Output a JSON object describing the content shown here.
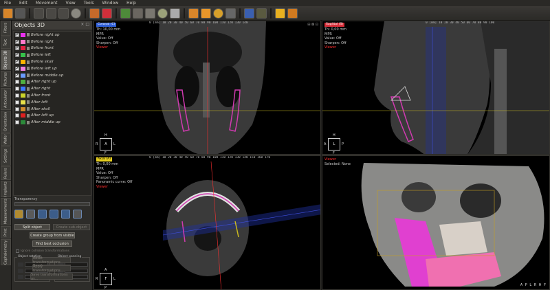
{
  "menu": [
    "File",
    "Edit",
    "Movement",
    "View",
    "Tools",
    "Window",
    "Help"
  ],
  "sidetabs": [
    "Filters",
    "Text",
    "Objects 3D",
    "Pictures",
    "Articulator",
    "Orientation",
    "Wafer",
    "Settings",
    "Rulers",
    "Implants",
    "Measurements",
    "Print",
    "Cephalometry"
  ],
  "panel": {
    "title": "Objects 3D",
    "controls": "× □",
    "objects": [
      {
        "name": "Before right up",
        "checked": true,
        "color": "#e830ee"
      },
      {
        "name": "Before right",
        "checked": true,
        "color": "#ff7ac8"
      },
      {
        "name": "Before front",
        "checked": true,
        "color": "#e02040"
      },
      {
        "name": "Before left",
        "checked": true,
        "color": "#35c24a"
      },
      {
        "name": "Before skull",
        "checked": true,
        "color": "#ffb400"
      },
      {
        "name": "Before left up",
        "checked": true,
        "color": "#f07ee0"
      },
      {
        "name": "Before middle up",
        "checked": true,
        "color": "#6a9bff"
      },
      {
        "name": "After right up",
        "checked": false,
        "color": "#4fb040"
      },
      {
        "name": "After right",
        "checked": false,
        "color": "#3b78ff"
      },
      {
        "name": "After front",
        "checked": false,
        "color": "#c9d22a"
      },
      {
        "name": "After left",
        "checked": false,
        "color": "#e8e04a"
      },
      {
        "name": "After skull",
        "checked": false,
        "color": "#d18a2c"
      },
      {
        "name": "After left up",
        "checked": false,
        "color": "#e02020"
      },
      {
        "name": "After middle up",
        "checked": false,
        "color": "#2c8a3a"
      }
    ],
    "transparency_label": "Transparency",
    "split_object": "Split object",
    "create_subobject": "Create sub-object",
    "create_group": "Create group from visible",
    "find_occlusion": "Find best occlusion",
    "ignore_label": "Ignore collision transformations",
    "rotation_title": "Object rotation",
    "panning_title": "Object panning",
    "btn_reset": "Reset transformations",
    "btn_apply": "Apply transformations",
    "btn_save": "Save transformations as..."
  },
  "viewports": {
    "coronal": {
      "tag": "Coronal (C)",
      "tag_color": "#2f5fd8",
      "ruler": "0 [mm]  10  20  30  40  50  60  70  80  90  100  110  120  130  140",
      "info": [
        "Th: 10,00 mm",
        "MPR",
        "Value: Off",
        "Sharpen: Off"
      ],
      "viewer": "Viewer",
      "orient": "A",
      "labels": [
        "H",
        "R",
        "L",
        "F"
      ]
    },
    "sagittal": {
      "tag": "Sagittal (S)",
      "tag_color": "#d82f3a",
      "ruler": "0 [mm]  10  20  30  40  50  60  70  80  90  100",
      "info": [
        "Th: 0,00 mm",
        "MPR",
        "Value: Off",
        "Sharpen: Off"
      ],
      "viewer": "Viewer",
      "orient": "L",
      "labels": [
        "H",
        "A",
        "P",
        "F"
      ]
    },
    "axial": {
      "tag": "Axial (A)",
      "tag_color": "#e8d020",
      "ruler": "0 [mm]  10  20  30  40  50  60  70  80  90  100  110  120  130  140  150  160  170",
      "info": [
        "Th: 0,00 mm",
        "MPR",
        "Value: Off",
        "Sharpen: Off",
        "Panoramic curve: Off"
      ],
      "viewer": "Viewer",
      "orient": "F",
      "labels": [
        "A",
        "R",
        "L",
        "P"
      ]
    },
    "volume": {
      "viewer": "Viewer",
      "info": "Selected: None",
      "corner": "A P L R H F"
    }
  }
}
